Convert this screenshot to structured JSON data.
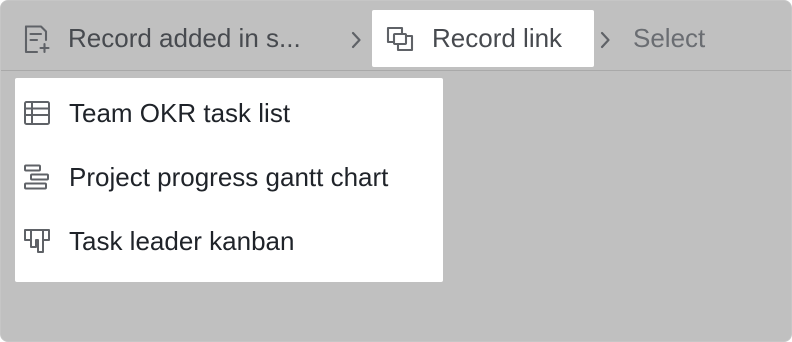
{
  "breadcrumb": {
    "items": [
      {
        "label": "Record added in s...",
        "icon": "record-added-icon",
        "state": "default"
      },
      {
        "label": "Record link",
        "icon": "record-link-icon",
        "state": "active"
      },
      {
        "label": "Select",
        "icon": "",
        "state": "placeholder"
      }
    ],
    "separator_icon": "chevron-right-icon"
  },
  "dropdown": {
    "options": [
      {
        "label": "Team OKR task list",
        "icon": "grid-table-icon"
      },
      {
        "label": "Project progress gantt chart",
        "icon": "gantt-icon"
      },
      {
        "label": "Task leader kanban",
        "icon": "kanban-icon"
      }
    ]
  },
  "colors": {
    "overlay": "#c0c0c0",
    "panel": "#ffffff",
    "text_primary": "#1f2329",
    "text_secondary": "#474a4f",
    "text_placeholder": "#6a6d72"
  }
}
